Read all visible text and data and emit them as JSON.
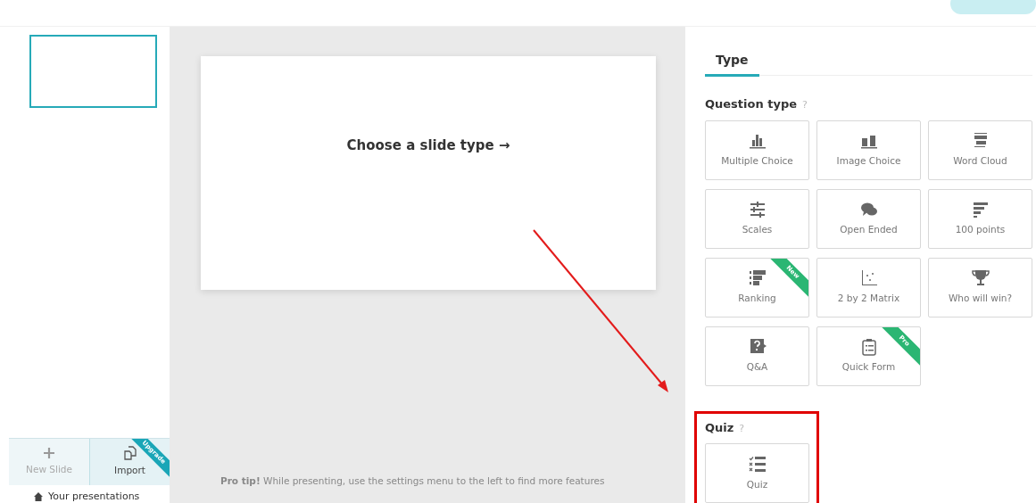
{
  "sidebar": {
    "slides": [
      {
        "selected": true
      }
    ],
    "actions": [
      {
        "kind": "new",
        "label": "New Slide",
        "disabled": true
      },
      {
        "kind": "import",
        "label": "Import",
        "disabled": false,
        "ribbon": {
          "label": "Upgrade",
          "color": "#1aa6b7"
        }
      }
    ],
    "footer_link": "Your presentations"
  },
  "canvas": {
    "slide_prompt": "Choose a slide type →",
    "tip": "**Pro tip!** While presenting, use the settings menu to the left to find more features"
  },
  "panel": {
    "tabs": [
      {
        "label": "Type",
        "selected": true
      }
    ],
    "sections": [
      {
        "title": "Question type",
        "help": "?",
        "highlighted": false,
        "types": [
          {
            "kind": "bars",
            "label": "Multiple Choice"
          },
          {
            "kind": "images",
            "label": "Image Choice"
          },
          {
            "kind": "cloud",
            "label": "Word Cloud"
          },
          {
            "kind": "sliders",
            "label": "Scales"
          },
          {
            "kind": "chat",
            "label": "Open Ended"
          },
          {
            "kind": "lines",
            "label": "100 points"
          },
          {
            "kind": "ranking",
            "label": "Ranking",
            "ribbon": {
              "label": "New",
              "color": "#2bb673"
            }
          },
          {
            "kind": "matrix",
            "label": "2 by 2 Matrix"
          },
          {
            "kind": "trophy",
            "label": "Who will win?"
          },
          {
            "kind": "qa",
            "label": "Q&A"
          },
          {
            "kind": "form",
            "label": "Quick Form",
            "ribbon": {
              "label": "Pro",
              "color": "#2bb673"
            }
          }
        ]
      },
      {
        "title": "Quiz",
        "help": "?",
        "highlighted": true,
        "types": [
          {
            "kind": "quiz",
            "label": "Quiz"
          }
        ]
      }
    ]
  }
}
